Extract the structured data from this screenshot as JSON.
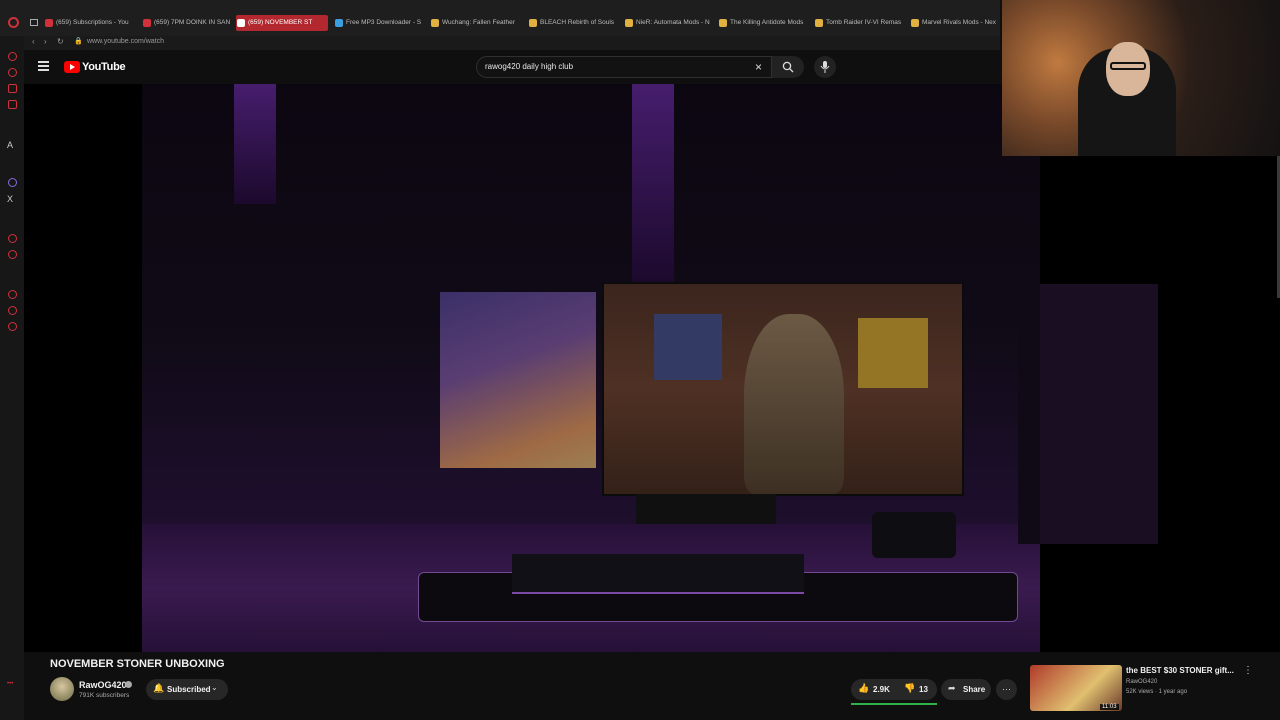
{
  "browser": {
    "tabs": [
      {
        "label": "(659) Subscriptions - You",
        "color": "#d0313b"
      },
      {
        "label": "(659) 7PM DOINK IN SAN",
        "color": "#d0313b"
      },
      {
        "label": "(659) NOVEMBER ST",
        "color": "#d0313b",
        "active": true
      },
      {
        "label": "Free MP3 Downloader - S",
        "color": "#3aa0e0"
      },
      {
        "label": "Wuchang: Fallen Feather",
        "color": "#e0b040"
      },
      {
        "label": "BLEACH Rebirth of Souls",
        "color": "#e0b040"
      },
      {
        "label": "NieR: Automata Mods - N",
        "color": "#e0b040"
      },
      {
        "label": "The Killing Antidote Mods",
        "color": "#e0b040"
      },
      {
        "label": "Tomb Raider IV-VI Remas",
        "color": "#e0b040"
      },
      {
        "label": "Marvel Rivals Mods - Nex",
        "color": "#e0b040"
      }
    ],
    "url": "www.youtube.com/watch"
  },
  "youtube": {
    "logo_text": "YouTube",
    "search_value": "rawog420 daily high club"
  },
  "video": {
    "title": "NOVEMBER STONER UNBOXING",
    "channel": "RawOG420",
    "subscribers": "791K subscribers",
    "subscribed_label": "Subscribed",
    "likes": "2.9K",
    "dislikes": "13",
    "share_label": "Share",
    "more": "···"
  },
  "recommendation": {
    "title": "the BEST $30 STONER gift...",
    "channel": "RawOG420",
    "meta": "52K views · 1 year ago",
    "duration": "11:03"
  },
  "icons": {
    "close": "×",
    "bell": "🔔",
    "thumb_up": "👍",
    "thumb_down": "👎",
    "share": "➦"
  }
}
